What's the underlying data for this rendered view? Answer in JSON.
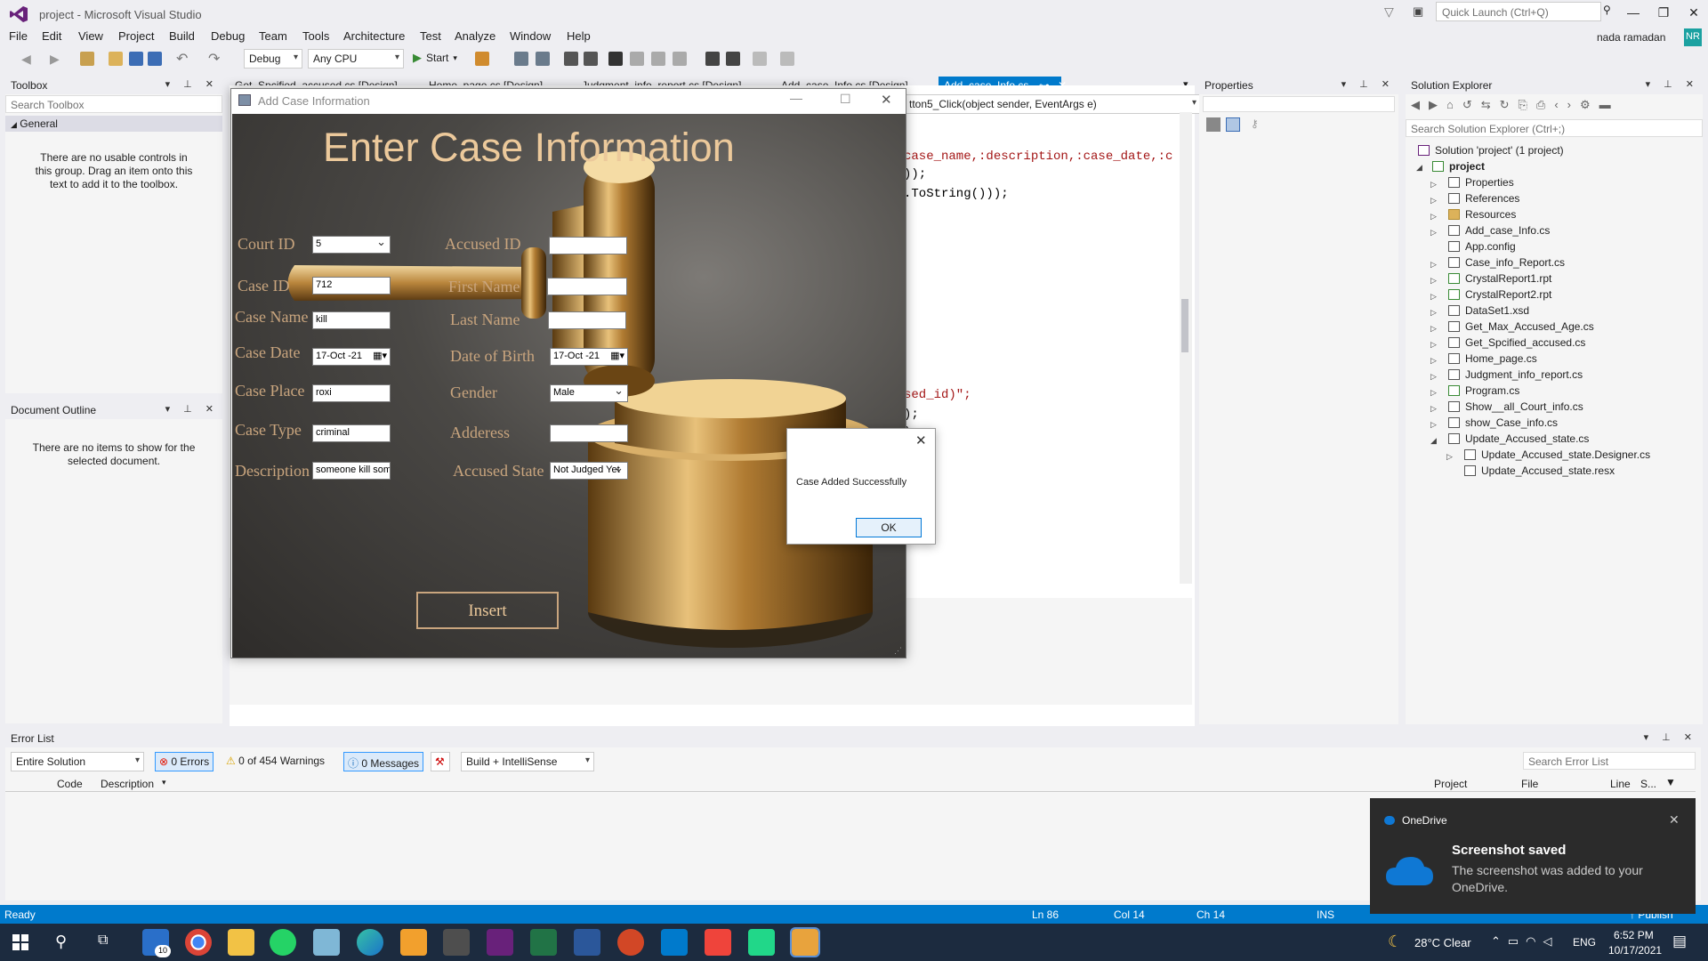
{
  "window": {
    "title": "project - Microsoft Visual Studio",
    "quick_launch": "Quick Launch (Ctrl+Q)",
    "user": "nada ramadan",
    "user_initials": "NR"
  },
  "menu": [
    "File",
    "Edit",
    "View",
    "Project",
    "Build",
    "Debug",
    "Team",
    "Tools",
    "Architecture",
    "Test",
    "Analyze",
    "Window",
    "Help"
  ],
  "toolbar": {
    "config": "Debug",
    "platform": "Any CPU",
    "start": "Start"
  },
  "toolbox": {
    "title": "Toolbox",
    "search": "Search Toolbox",
    "group": "General",
    "message": "There are no usable controls in this group. Drag an item onto this text to add it to the toolbox."
  },
  "outline": {
    "title": "Document Outline",
    "message": "There are no items to show for the selected document."
  },
  "tabs": [
    "Get_Spcified_accused.cs [Design]",
    "Home_page.cs [Design]",
    "Judgment_info_report.cs [Design]",
    "Add_case_Info.cs [Design]",
    "Add_case_Info.cs"
  ],
  "editor": {
    "member_dropdown": "tton5_Click(object sender, EventArgs e)",
    "lines": [
      "case_name,:description,:case_date,:c",
      "));",
      ".ToString()));",
      "sed_id)\";",
      ");",
      ");"
    ]
  },
  "properties": {
    "title": "Properties"
  },
  "solution": {
    "title": "Solution Explorer",
    "search": "Search Solution Explorer (Ctrl+;)",
    "items": [
      "Solution 'project' (1 project)",
      "project",
      "Properties",
      "References",
      "Resources",
      "Add_case_Info.cs",
      "App.config",
      "Case_info_Report.cs",
      "CrystalReport1.rpt",
      "CrystalReport2.rpt",
      "DataSet1.xsd",
      "Get_Max_Accused_Age.cs",
      "Get_Spcified_accused.cs",
      "Home_page.cs",
      "Judgment_info_report.cs",
      "Program.cs",
      "Show__all_Court_info.cs",
      "show_Case_info.cs",
      "Update_Accused_state.cs",
      "Update_Accused_state.Designer.cs",
      "Update_Accused_state.resx"
    ]
  },
  "form": {
    "window_title": "Add Case Information",
    "heading": "Enter Case Information",
    "labels": {
      "court_id": "Court ID",
      "case_id": "Case ID",
      "case_name": "Case Name",
      "case_date": "Case Date",
      "case_place": "Case Place",
      "case_type": "Case Type",
      "description": "Description",
      "accused_id": "Accused ID",
      "first_name": "First Name",
      "last_name": "Last Name",
      "dob": "Date of Birth",
      "gender": "Gender",
      "address": "Adderess",
      "accused_state": "Accused State"
    },
    "values": {
      "court_id": "5",
      "case_id": "712",
      "case_name": "kill",
      "case_date": "17-Oct -21",
      "case_place": "roxi",
      "case_type": "criminal",
      "description": "someone kill someone",
      "accused_id": "",
      "first_name": "",
      "last_name": "",
      "dob": "17-Oct -21",
      "gender": "Male",
      "address": "",
      "accused_state": "Not Judged Yet"
    },
    "insert": "Insert"
  },
  "msgbox": {
    "text": "Case Added Successfully",
    "ok": "OK"
  },
  "errorlist": {
    "title": "Error List",
    "scope": "Entire Solution",
    "errors": "0 Errors",
    "warnings": "0 of 454 Warnings",
    "messages": "0 Messages",
    "build": "Build + IntelliSense",
    "search": "Search Error List",
    "cols": [
      "Code",
      "Description",
      "Project",
      "File",
      "Line",
      "S..."
    ]
  },
  "status": {
    "ready": "Ready",
    "ln": "Ln 86",
    "col": "Col 14",
    "ch": "Ch 14",
    "ins": "INS",
    "publish": "↑ Publish"
  },
  "toast": {
    "app": "OneDrive",
    "title": "Screenshot saved",
    "body": "The screenshot was added to your OneDrive."
  },
  "tray": {
    "weather": "28°C  Clear",
    "lang": "ENG",
    "time": "6:52 PM",
    "date": "10/17/2021",
    "mail_badge": "10"
  },
  "colors": {
    "accent": "#007acc",
    "vs_purple": "#68217a",
    "gold": "#c9a57e"
  }
}
